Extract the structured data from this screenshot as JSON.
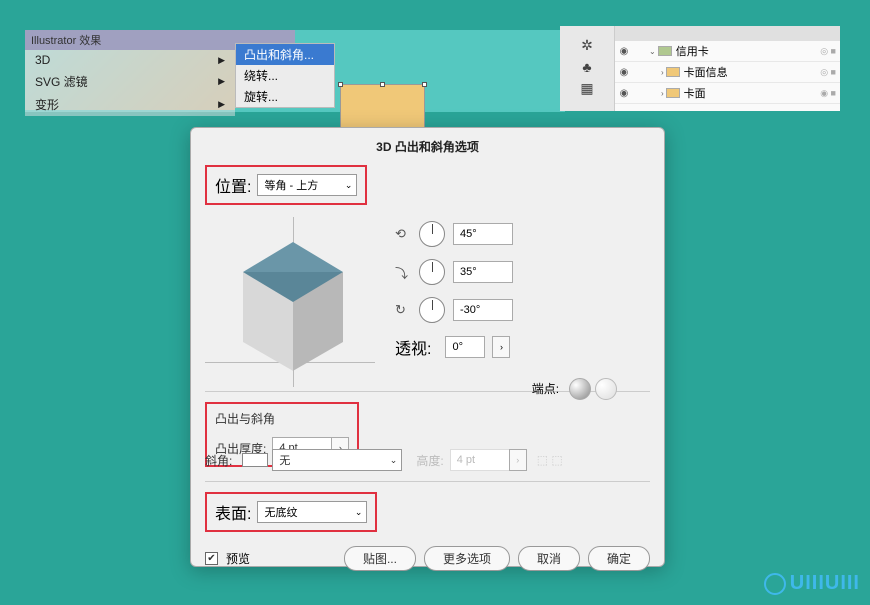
{
  "illustrator": {
    "title": "Illustrator 效果",
    "menu": [
      {
        "label": "3D",
        "has_sub": true,
        "selected": true
      },
      {
        "label": "SVG 滤镜",
        "has_sub": true
      },
      {
        "label": "变形",
        "has_sub": true
      }
    ],
    "submenu": [
      {
        "label": "凸出和斜角...",
        "selected": true
      },
      {
        "label": "绕转...",
        "selected": false
      },
      {
        "label": "旋转...",
        "selected": false
      }
    ]
  },
  "layers": {
    "items": [
      {
        "name": "信用卡",
        "swatch": "#b0c890",
        "indent": 0,
        "expanded": true,
        "target": "◎ ■"
      },
      {
        "name": "卡面信息",
        "swatch": "#f0c878",
        "indent": 1,
        "expanded": false,
        "target": "◎ ■"
      },
      {
        "name": "卡面",
        "swatch": "#f0c878",
        "indent": 1,
        "expanded": false,
        "target": "◉ ■"
      }
    ]
  },
  "dialog": {
    "title": "3D 凸出和斜角选项",
    "position": {
      "label": "位置:",
      "value": "等角 - 上方"
    },
    "angles": {
      "x": "45°",
      "y": "35°",
      "z": "-30°"
    },
    "perspective": {
      "label": "透视:",
      "value": "0°"
    },
    "extrude_section": "凸出与斜角",
    "extrude_depth": {
      "label": "凸出厚度:",
      "value": "4 pt"
    },
    "cap": {
      "label": "端点:"
    },
    "bevel": {
      "label": "斜角:",
      "value": "无"
    },
    "height": {
      "label": "高度:",
      "value": "4 pt"
    },
    "surface": {
      "label": "表面:",
      "value": "无底纹"
    },
    "preview": "预览",
    "buttons": {
      "map": "贴图...",
      "more": "更多选项",
      "cancel": "取消",
      "ok": "确定"
    }
  },
  "watermark": "UIIIUIII"
}
